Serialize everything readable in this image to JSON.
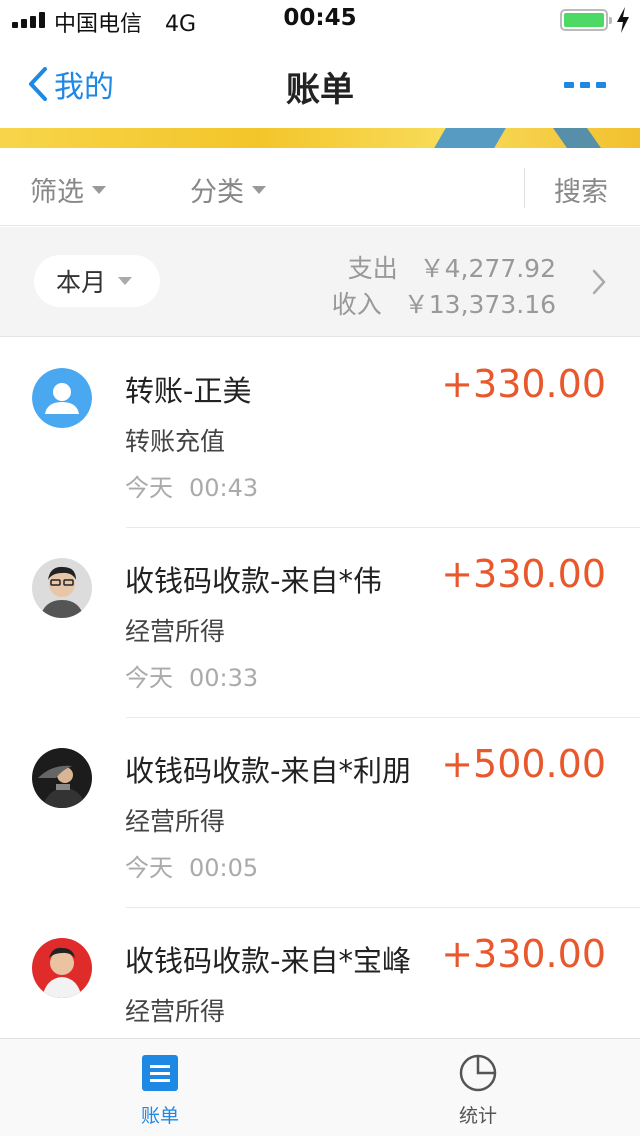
{
  "status_bar": {
    "carrier": "中国电信",
    "network": "4G",
    "time": "00:45",
    "battery_level": 1.0
  },
  "nav": {
    "back_label": "我的",
    "title": "账单"
  },
  "filter": {
    "filter_label": "筛选",
    "category_label": "分类",
    "search_label": "搜索"
  },
  "summary": {
    "period": "本月",
    "expense_label": "支出",
    "expense_amount": "￥4,277.92",
    "income_label": "收入",
    "income_amount": "￥13,373.16"
  },
  "transactions": [
    {
      "title": "转账-正美",
      "amount": "+330.00",
      "category": "转账充值",
      "day": "今天",
      "time": "00:43",
      "avatar": "default-user-icon"
    },
    {
      "title": "收钱码收款-来自*伟",
      "amount": "+330.00",
      "category": "经营所得",
      "day": "今天",
      "time": "00:33",
      "avatar": "photo"
    },
    {
      "title": "收钱码收款-来自*利朋",
      "amount": "+500.00",
      "category": "经营所得",
      "day": "今天",
      "time": "00:05",
      "avatar": "photo"
    },
    {
      "title": "收钱码收款-来自*宝峰",
      "amount": "+330.00",
      "category": "经营所得",
      "day": "",
      "time": "",
      "avatar": "photo"
    }
  ],
  "tabbar": {
    "bill_label": "账单",
    "stats_label": "统计"
  },
  "colors": {
    "accent": "#1e88e5",
    "amount": "#e8582c",
    "battery": "#4cd964"
  }
}
